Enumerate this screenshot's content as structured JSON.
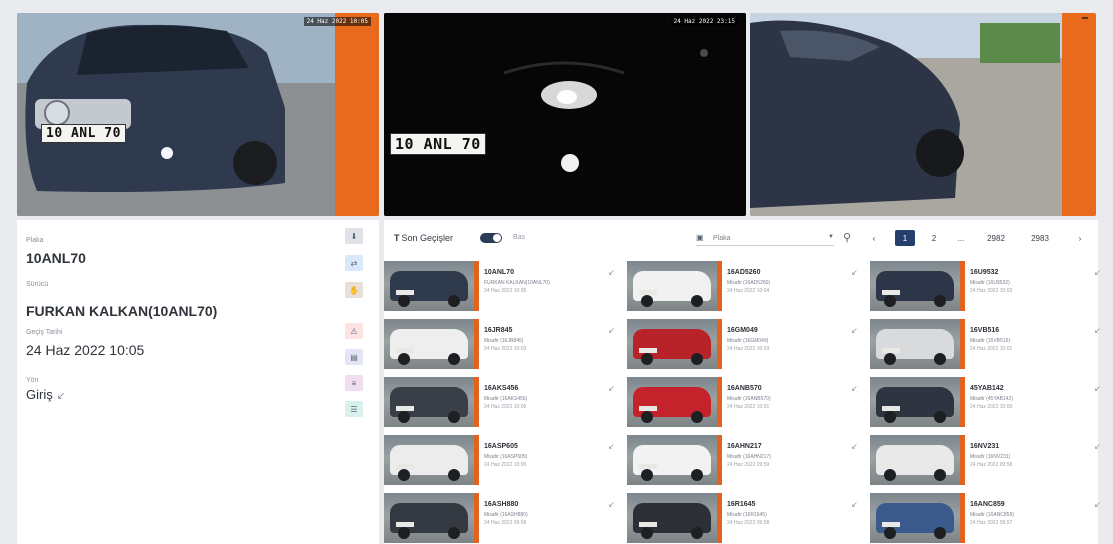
{
  "cameras": [
    {
      "stamp": "24 Haz 2022 10:05",
      "plate": "10 ANL 70"
    },
    {
      "stamp": "24 Haz 2022 23:15",
      "plate": "10 ANL 70"
    },
    {
      "stamp": ""
    }
  ],
  "details": {
    "plate_label": "Plaka",
    "plate": "10ANL70",
    "owner_label": "Sürücü",
    "owner": "FURKAN KALKAN(10ANL70)",
    "date_label": "Geçiş Tarihi",
    "date": "24 Haz 2022 10:05",
    "direction_label": "Yön",
    "direction": "Giriş",
    "side_buttons": [
      {
        "icon": "download-icon",
        "glyph": "⬇",
        "color": "#dfe3e8"
      },
      {
        "icon": "link-icon",
        "glyph": "⇄",
        "color": "#d9e8fb"
      },
      {
        "icon": "hand-icon",
        "glyph": "✋",
        "color": "#e9dfd9"
      },
      {
        "icon": "alert-icon",
        "glyph": "⚠",
        "color": "#fde2e2"
      },
      {
        "icon": "image-icon",
        "glyph": "▤",
        "color": "#e4e4f7"
      },
      {
        "icon": "list-icon",
        "glyph": "≡",
        "color": "#f0ddf0"
      },
      {
        "icon": "sliders-icon",
        "glyph": "☰",
        "color": "#d8f1ec"
      }
    ]
  },
  "gallery": {
    "title": "Son Geçişler",
    "subtitle": "Bas",
    "filter_label": "Plaka",
    "pages": [
      "‹",
      "1",
      "2",
      "...",
      "2982",
      "2983",
      "›"
    ],
    "cards": [
      {
        "plate": "10ANL70",
        "owner": "FURKAN KALKAN(10ANL70)",
        "date": "24 Haz 2022 10:05",
        "car": "#2f3a4d"
      },
      {
        "plate": "16AD5260",
        "owner": "Misafir (16AD5260)",
        "date": "24 Haz 2022 10:04",
        "car": "#f1f1f1"
      },
      {
        "plate": "16U9532",
        "owner": "Misafir (16U9532)",
        "date": "24 Haz 2022 10:03",
        "car": "#2d3648"
      },
      {
        "plate": "16JR845",
        "owner": "Misafir (16JR845)",
        "date": "24 Haz 2022 10:03",
        "car": "#eeeeee"
      },
      {
        "plate": "16GM049",
        "owner": "Misafir (16GM049)",
        "date": "24 Haz 2022 10:03",
        "car": "#b8232a"
      },
      {
        "plate": "16VB516",
        "owner": "Misafir (16VB516)",
        "date": "24 Haz 2022 10:01",
        "car": "#d9dadc"
      },
      {
        "plate": "16AKS456",
        "owner": "Misafir (16AKS456)",
        "date": "24 Haz 2022 10:00",
        "car": "#3a3f47"
      },
      {
        "plate": "16ANB570",
        "owner": "Misafir (16ANB570)",
        "date": "24 Haz 2022 10:01",
        "car": "#c4232b"
      },
      {
        "plate": "45YAB142",
        "owner": "Misafir (45YAB142)",
        "date": "24 Haz 2022 10:00",
        "car": "#2e3440"
      },
      {
        "plate": "16ASP605",
        "owner": "Misafir (16ASP605)",
        "date": "24 Haz 2022 10:00",
        "car": "#ececec"
      },
      {
        "plate": "16AHN217",
        "owner": "Misafir (16AHN217)",
        "date": "24 Haz 2022 09:59",
        "car": "#f2f2f2"
      },
      {
        "plate": "16NV231",
        "owner": "Misafir (16NV231)",
        "date": "24 Haz 2022 09:58",
        "car": "#e9e9e9"
      },
      {
        "plate": "16ASH880",
        "owner": "Misafir (16ASH880)",
        "date": "24 Haz 2022 09:58",
        "car": "#353a42"
      },
      {
        "plate": "16R1645",
        "owner": "Misafir (16R1645)",
        "date": "24 Haz 2022 09:58",
        "car": "#2c2f35"
      },
      {
        "plate": "16ANC859",
        "owner": "Misafir (16ANC859)",
        "date": "24 Haz 2022 09:57",
        "car": "#3a5a8c"
      }
    ]
  }
}
